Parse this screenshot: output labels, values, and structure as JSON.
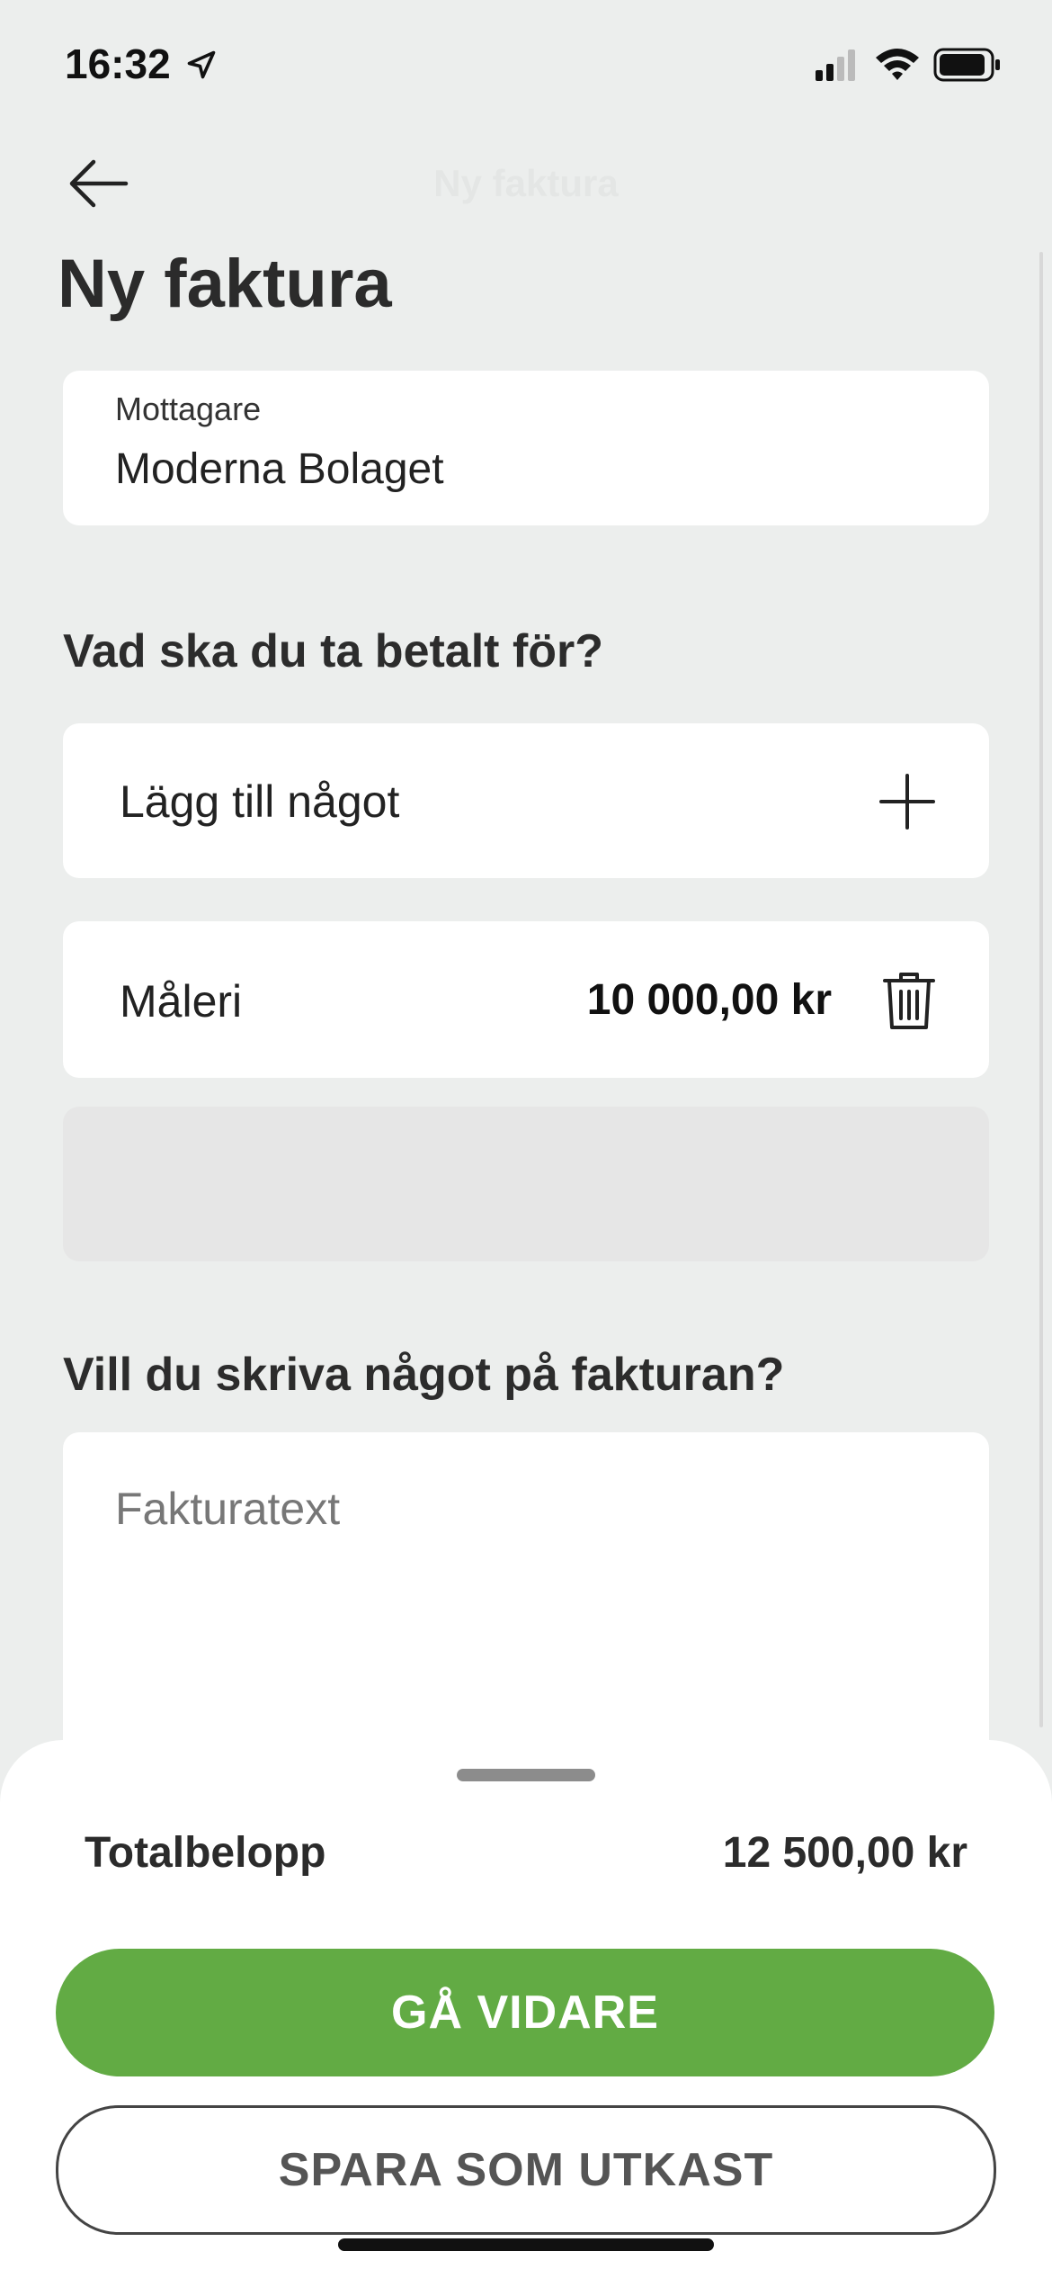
{
  "status_bar": {
    "time": "16:32"
  },
  "nav": {
    "title": "Ny faktura"
  },
  "page": {
    "title": "Ny faktura"
  },
  "recipient": {
    "label": "Mottagare",
    "value": "Moderna Bolaget"
  },
  "section_items": {
    "title": "Vad ska du ta betalt för?"
  },
  "add_item": {
    "label": "Lägg till något"
  },
  "items": [
    {
      "name": "Måleri",
      "amount": "10 000,00 kr"
    }
  ],
  "section_text": {
    "title": "Vill du skriva något på fakturan?"
  },
  "invoice_text": {
    "placeholder": "Fakturatext"
  },
  "summary": {
    "total_label": "Totalbelopp",
    "total_value": "12 500,00 kr"
  },
  "buttons": {
    "continue": "GÅ VIDARE",
    "save_draft": "SPARA SOM UTKAST"
  },
  "colors": {
    "accent": "#62ab44",
    "background": "#eceeed"
  }
}
